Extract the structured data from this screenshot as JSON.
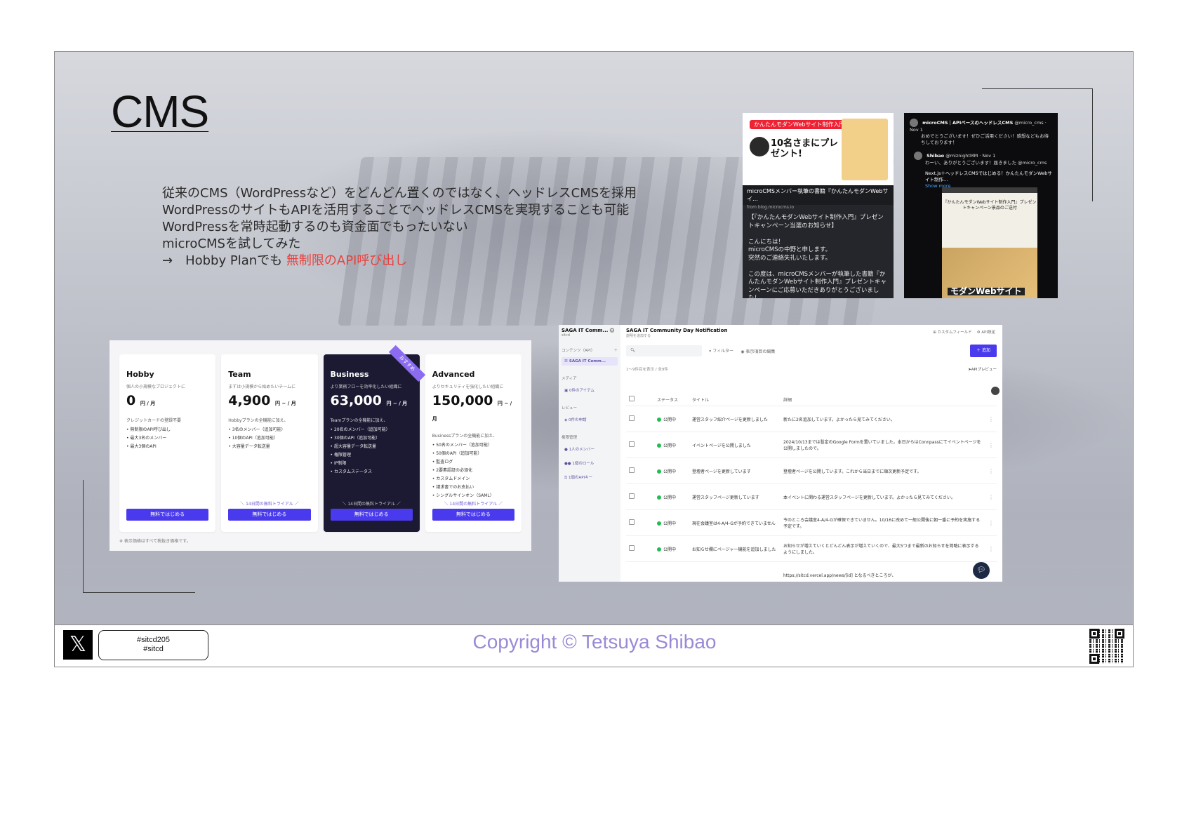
{
  "slide": {
    "title": "CMS",
    "bullets": [
      "従来のCMS（WordPressなど）をどんどん置くのではなく、ヘッドレスCMSを採用",
      "WordPressのサイトもAPIを活用することでヘッドレスCMSを実現することも可能",
      "WordPressを常時起動するのも資金面でもったいない",
      "microCMSを試してみた"
    ],
    "arrow_line_prefix": "→　Hobby Planでも ",
    "arrow_line_highlight": "無制限のAPI呼び出し",
    "highlight_color": "#e8413d"
  },
  "promo": {
    "pill": "かんたんモダンWebサイト制作入門",
    "big_text": "10名さまにプレゼント!",
    "caption": "microCMSメンバー執筆の書籍『かんたんモダンWebサイ…",
    "source": "from blog.microcms.io",
    "body": "【『かんたんモダンWebサイト制作入門』プレゼントキャンペーン当選のお知らせ】\n\nこんにちは！\nmicroCMSの中野と申します。\n突然のご連絡失礼いたします。\n\nこの度は、microCMSメンバーが執筆した書籍『かんたんモダンWebサイト制作入門』プレゼントキャンペーンにご応募いただきありがとうございました！\n厳正なる抽選の結果、Shibao様が当選されましたのでお知らせいたします🎉"
  },
  "tweet": {
    "name": "microCMS｜APIベースのヘッドレスCMS",
    "handle": "@micro_cms · Nov 1",
    "text": "おめでとうございます！ぜひご活用ください！感想などもお待ちしております！",
    "reply_name": "Shibao",
    "reply_handle": "@miznightMM · Nov 1",
    "reply_text": "わーい、ありがとうございます！届きました @micro_cms",
    "link_text": "Next.js＋ヘッドレスCMSではじめる！かんたんモダンWebサイト制作…",
    "show_more": "Show more",
    "card_title": "『かんたんモダンWebサイト制作入門』プレゼントキャンペーン景品のご送付",
    "card_book": "モダンWebサイト"
  },
  "pricing": {
    "plans": [
      {
        "name": "Hobby",
        "desc": "個人の小規模なプロジェクトに",
        "price": "0",
        "unit": "円 / 月",
        "note": "クレジットカードの登録不要",
        "features": [
          "無制限のAPI呼び出し",
          "最大3名のメンバー",
          "最大3個のAPI"
        ],
        "trial": "",
        "cta": "無料ではじめる"
      },
      {
        "name": "Team",
        "desc": "まずは小規模から始めたいチームに",
        "price": "4,900",
        "unit": "円 ~ / 月",
        "note": "Hobbyプランの全機能に加え、",
        "features": [
          "3名のメンバー（追加可能）",
          "10個のAPI（追加可能）",
          "大容量データ転送量"
        ],
        "trial": "＼ 14日間の無料トライアル ／",
        "cta": "無料ではじめる"
      },
      {
        "name": "Business",
        "desc": "より業務フローを効率化したい組織に",
        "price": "63,000",
        "unit": "円 ~ / 月",
        "note": "Teamプランの全機能に加え、",
        "features": [
          "20名のメンバー（追加可能）",
          "30個のAPI（追加可能）",
          "超大容量データ転送量",
          "権限管理",
          "IP制限",
          "カスタムステータス"
        ],
        "trial": "＼ 14日間の無料トライアル ／",
        "cta": "無料ではじめる",
        "ribbon": "おすすめ"
      },
      {
        "name": "Advanced",
        "desc": "よりセキュリティを強化したい組織に",
        "price": "150,000",
        "unit": "円 ~ / 月",
        "note": "Businessプランの全機能に加え、",
        "features": [
          "50名のメンバー（追加可能）",
          "50個のAPI（追加可能）",
          "監査ログ",
          "2要素認証の必須化",
          "カスタムドメイン",
          "請求書でのお支払い",
          "シングルサインオン（SAML）"
        ],
        "trial": "＼ 14日間の無料トライアル ／",
        "cta": "無料ではじめる"
      }
    ],
    "tax_note": "※ 表示価格はすべて税抜き価格です。"
  },
  "admin": {
    "app_name": "SAGA IT Comm...",
    "app_sub": "sitcd",
    "content_label": "コンテンツ（API）",
    "active_api": "SAGA IT Comm...",
    "media_label": "メディア",
    "media_item": "0件のアイテム",
    "review_label": "レビュー",
    "review_item": "0件の申請",
    "perm_label": "権限管理",
    "perm_items": [
      "1人のメンバー",
      "1個のロール",
      "1個のAPIキー"
    ],
    "title": "SAGA IT Community Day Notification",
    "desc": "説明を追加する",
    "custom_field": "カスタムフィールド",
    "api_settings": "API設定",
    "filter": "フィルター",
    "edit_columns": "表示項目の編集",
    "add": "＋ 追加",
    "count": "1〜9件目を表示 / 全9件",
    "api_preview": "APIプレビュー",
    "columns": [
      "ステータス",
      "タイトル",
      "詳細"
    ],
    "rows": [
      {
        "status": "公開中",
        "title": "運営スタッフ紹介ページを更新しました",
        "detail": "新たに2名追加しています。よかったら見てみてください。"
      },
      {
        "status": "公開中",
        "title": "イベントページを公開しました",
        "detail": "2024/10/13までは暫定のGoogle Formを置いていました。本日からはConnpassにてイベントページを公開しましたので。"
      },
      {
        "status": "公開中",
        "title": "登壇者ページを更新しています",
        "detail": "登壇者ページを公開しています。これから当日までに順次更新予定です。"
      },
      {
        "status": "公開中",
        "title": "運営スタッフページ更新しています",
        "detail": "本イベントに関わる運営スタッフページを更新しています。よかったら見てみてください。"
      },
      {
        "status": "公開中",
        "title": "現在会議室は4-A/4-Gが予約できていません",
        "detail": "今のところ会議室4-A/4-Gが確保できていません。10/16に改めて一般公開後に朝一番に予約を実施する予定です。"
      },
      {
        "status": "公開中",
        "title": "お知らせ欄にページャー機能を追加しました",
        "detail": "お知らせが増えていくとどんどん表示が増えていくので、最大5つまで最新のお知らせを简略に表示するようにしました。"
      },
      {
        "status": "",
        "title": "",
        "detail": "https://sitcd.vercel.app/news/[id] となるべきところが、"
      }
    ]
  },
  "footer": {
    "x_logo": "𝕏",
    "hashtags": [
      "#sitcd205",
      "#sitcd"
    ],
    "copyright": "Copyright © Tetsuya Shibao"
  }
}
